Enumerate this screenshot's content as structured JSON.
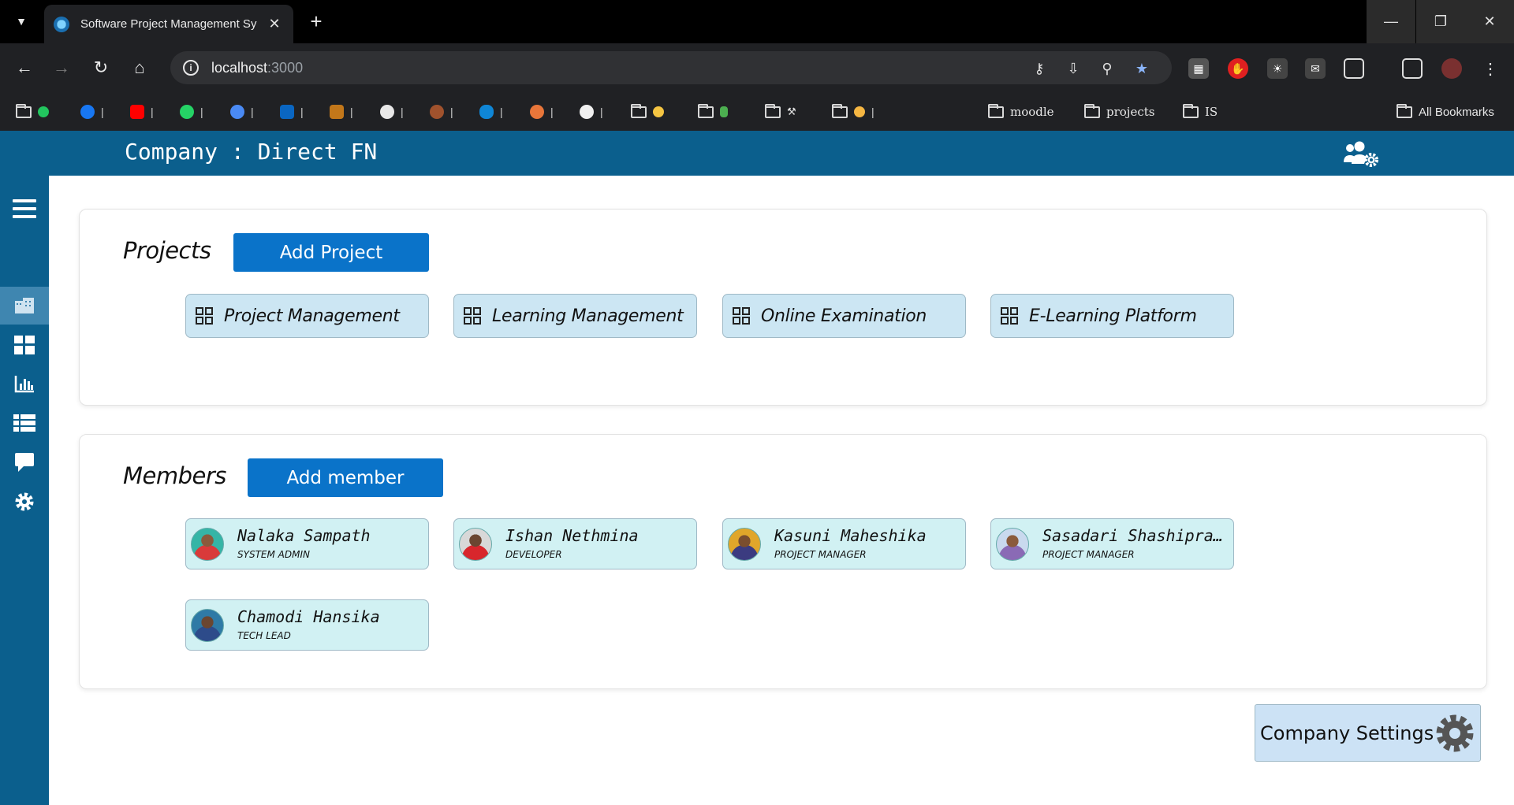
{
  "browser": {
    "tab_title": "Software Project Management Sy",
    "url_host": "localhost",
    "url_port": ":3000",
    "bookmarks": [
      "moodle",
      "projects",
      "IS"
    ],
    "all_bookmarks": "All Bookmarks"
  },
  "header": {
    "company_title": "Company : Direct FN"
  },
  "projects": {
    "title": "Projects",
    "add_label": "Add Project",
    "items": [
      {
        "name": "Project Management"
      },
      {
        "name": "Learning Management"
      },
      {
        "name": "Online Examination"
      },
      {
        "name": "E-Learning Platform"
      }
    ]
  },
  "members": {
    "title": "Members",
    "add_label": "Add member",
    "items": [
      {
        "name": "Nalaka Sampath",
        "role": "SYSTEM ADMIN"
      },
      {
        "name": "Ishan Nethmina",
        "role": "DEVELOPER"
      },
      {
        "name": "Kasuni Maheshika",
        "role": "PROJECT MANAGER"
      },
      {
        "name": "Sasadari Shashipra...",
        "role": "PROJECT MANAGER"
      },
      {
        "name": "Chamodi Hansika",
        "role": "TECH LEAD"
      }
    ]
  },
  "settings": {
    "label": "Company Settings"
  },
  "colors": {
    "header_bg": "#0b5f8d",
    "primary_button": "#0a73c9",
    "project_card_bg": "#cce6f3",
    "member_card_bg": "#d1f1f3"
  }
}
